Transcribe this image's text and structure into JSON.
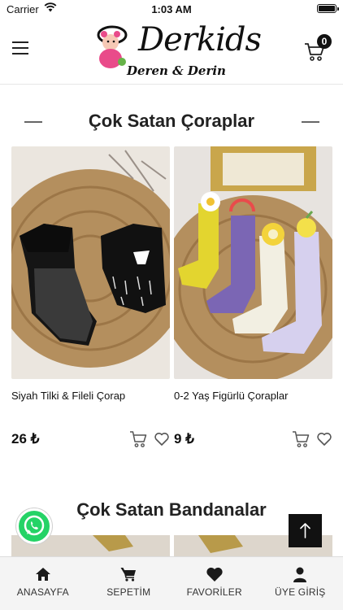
{
  "status_bar": {
    "carrier": "Carrier",
    "time": "1:03 AM"
  },
  "header": {
    "logo_brand": "Derkids",
    "logo_sub": "Deren & Derin",
    "cart_count": "0"
  },
  "sections": [
    {
      "title": "Çok Satan Çoraplar",
      "products": [
        {
          "name": "Siyah Tilki & Fileli Çorap",
          "price": "26 ₺"
        },
        {
          "name": "0-2 Yaş Figürlü Çoraplar",
          "price": "9 ₺"
        }
      ]
    },
    {
      "title": "Çok Satan Bandanalar"
    }
  ],
  "bottom_nav": [
    {
      "label": "ANASAYFA",
      "icon": "home-icon"
    },
    {
      "label": "SEPETİM",
      "icon": "cart-icon"
    },
    {
      "label": "FAVORİLER",
      "icon": "heart-icon"
    },
    {
      "label": "ÜYE GİRİŞ",
      "icon": "user-icon"
    }
  ],
  "colors": {
    "accent": "#111111",
    "whatsapp": "#25d366",
    "nav_bg": "#f4f4f4"
  }
}
